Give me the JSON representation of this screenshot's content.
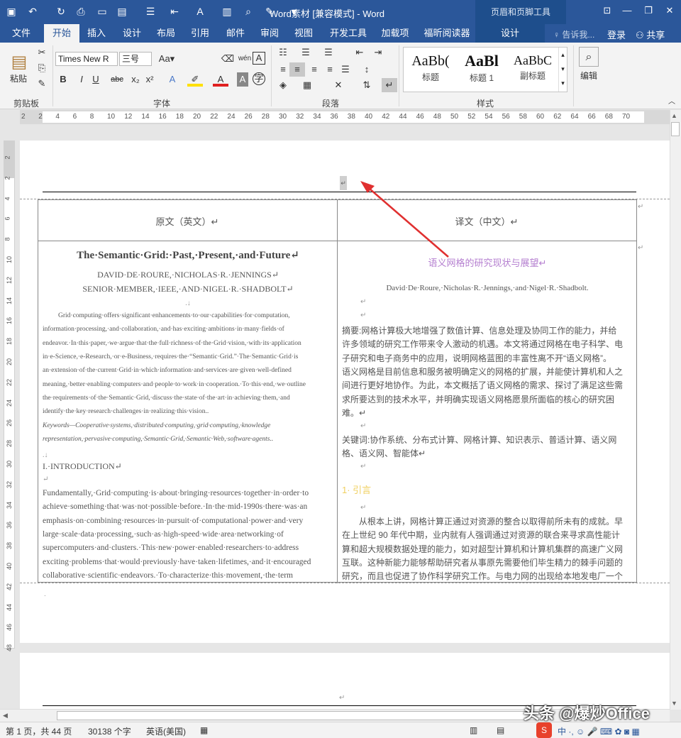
{
  "window": {
    "title": "Word素材 [兼容模式] - Word",
    "context_tools": "页眉和页脚工具",
    "min": "—",
    "restore": "❐",
    "close": "✕",
    "ribbon_opt": "⊡"
  },
  "tabs": {
    "file": "文件",
    "home": "开始",
    "insert": "插入",
    "design": "设计",
    "layout": "布局",
    "references": "引用",
    "mailings": "邮件",
    "review": "审阅",
    "view": "视图",
    "developer": "开发工具",
    "addins": "加载项",
    "foxit": "福昕阅读器",
    "hf_design": "设计",
    "tell": "告诉我...",
    "login": "登录",
    "share": "共享"
  },
  "ribbon": {
    "paste": "粘贴",
    "clipboard": "剪贴板",
    "font_name": "Times New R",
    "font_size": "三号",
    "font_group": "字体",
    "para_group": "段落",
    "styles_group": "样式",
    "edit": "编辑",
    "styles": [
      {
        "sample": "AaBb(",
        "name": "标题"
      },
      {
        "sample": "AaBl",
        "name": "标题 1"
      },
      {
        "sample": "AaBbC",
        "name": "副标题"
      }
    ]
  },
  "ruler": {
    "h": [
      "2",
      "2",
      "4",
      "6",
      "8",
      "10",
      "12",
      "14",
      "16",
      "18",
      "20",
      "22",
      "24",
      "26",
      "28",
      "30",
      "32",
      "34",
      "36",
      "38",
      "40",
      "42",
      "44",
      "46",
      "48",
      "50",
      "52",
      "54",
      "56",
      "58",
      "60",
      "62",
      "64",
      "66",
      "68",
      "70"
    ],
    "v": [
      "2",
      "2",
      "4",
      "6",
      "8",
      "10",
      "12",
      "14",
      "16",
      "18",
      "20",
      "22",
      "24",
      "26",
      "28",
      "30",
      "32",
      "34",
      "36",
      "38",
      "40",
      "42",
      "44",
      "46",
      "48"
    ]
  },
  "doc": {
    "mark": "↵",
    "col_en": "原文（英文）↵",
    "col_cn": "译文（中文）↵",
    "en_title": "The·Semantic·Grid:·Past,·Present,·and·Future↵",
    "en_authors1": "DAVID·DE·ROURE,·NICHOLAS·R.·JENNINGS↵",
    "en_authors2": "SENIOR·MEMBER,·IEEE,·AND·NIGEL·R.·SHADBOLT↵",
    "en_abstract": [
      "Grid·computing·offers·significant·enhancements·to·our·capabilities·for·computation,",
      "information·processing,·and·collaboration,·and·has·exciting·ambitions·in·many·fields·of",
      "endeavor.·In·this·paper,·we·argue·that·the·full·richness·of·the·Grid·vision,·with·its·application",
      "in·e-Science,·e-Research,·or·e-Business,·requires·the·“Semantic·Grid.”·The·Semantic·Grid·is",
      "an·extension·of·the·current·Grid·in·which·information·and·services·are·given·well-defined",
      "meaning,·better·enabling·computers·and·people·to·work·in·cooperation.·To·this·end,·we·outline",
      "the·requirements·of·the·Semantic·Grid,·discuss·the·state·of·the·art·in·achieving·them,·and",
      "identify·the·key·research·challenges·in·realizing·this·vision.."
    ],
    "en_keywords": [
      "Keywords—Cooperative·systems,·distributed·computing,·grid·computing,·knowledge",
      "representation,·pervasive·computing,·Semantic·Grid,·Semantic·Web,·software·agents.."
    ],
    "en_intro_head": "I.·INTRODUCTION↵",
    "en_intro": [
      "Fundamentally,·Grid·computing·is·about·bringing·resources·together·in·order·to",
      "achieve·something·that·was·not·possible·before.·In·the·mid-1990s·there·was·an",
      "emphasis·on·combining·resources·in·pursuit·of·computational·power·and·very",
      "large·scale·data·processing,·such·as·high-speed·wide·area·networking·of",
      "supercomputers·and·clusters.·This·new·power·enabled·researchers·to·address",
      "exciting·problems·that·would·previously·have·taken·lifetimes,·and·it·encouraged",
      "collaborative·scientific·endeavors.·To·characterize·this·movement,·the·term"
    ],
    "cn_title": "语义网格的研究现状与展望↵",
    "cn_authors": "David·De·Roure,·Nicholas·R.·Jennings,·and·Nigel·R.·Shadbolt.",
    "cn_abstract": [
      "摘要:网格计算极大地增强了数值计算、信息处理及协同工作的能力，并给",
      "许多领域的研究工作带来令人激动的机遇。本文将通过网格在电子科学、电",
      "子研究和电子商务中的应用，说明网格蓝图的丰富性离不开“语义网格”。",
      "语义网格是目前信息和服务被明确定义的网格的扩展，并能使计算机和人之",
      "间进行更好地协作。为此，本文概括了语义网格的需求、探讨了满足这些需",
      "求所要达到的技术水平，并明确实现语义网格愿景所面临的核心的研究困",
      "难。↵"
    ],
    "cn_keywords": [
      "关键词:协作系统、分布式计算、网格计算、知识表示、普适计算、语义网",
      "格、语义网、智能体↵"
    ],
    "cn_intro_head": "1· 引言",
    "cn_intro": [
      "从根本上讲，网格计算正通过对资源的整合以取得前所未有的成就。早",
      "在上世纪 90 年代中期，业内就有人强调通过对资源的联合来寻求高性能计",
      "算和超大规模数据处理的能力，如对超型计算机和计算机集群的高速广义网",
      "互联。这种新能力能够帮助研究者从事原先需要他们毕生精力的棘手问题的",
      "研究，而且也促进了协作科学研究工作。与电力网的出现给本地发电厂一个"
    ]
  },
  "status": {
    "page": "第 1 页，共 44 页",
    "words": "30138 个字",
    "lang": "英语(美国)",
    "watermark": "头条 @爆炒Office"
  },
  "colors": {
    "accent": "#2b579a",
    "cn_title": "#b57fd0",
    "cn_intro_head": "#f0d060",
    "arrow": "#e03030"
  }
}
